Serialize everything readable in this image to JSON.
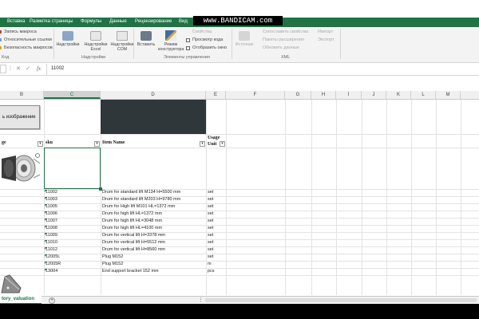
{
  "ribbon_tabs": [
    "Вставка",
    "Разметка страницы",
    "Формулы",
    "Данные",
    "Рецензирование",
    "Вид"
  ],
  "watermark": "www.BANDICAM.com",
  "ribbon": {
    "code_group": {
      "items": [
        "Запись макроса",
        "Относительные ссылки",
        "Безопасность макросов"
      ],
      "name": "Код"
    },
    "addins_group": {
      "buttons": [
        "Надстройки",
        "Надстройки Excel",
        "Надстройки COM"
      ],
      "name": "Надстройки"
    },
    "controls_group": {
      "insert_label": "Вставить",
      "design_mode_label": "Режим конструктора",
      "items": [
        "Свойства",
        "Просмотр кода",
        "Отобразить окно"
      ],
      "name": "Элементы управления"
    },
    "xml_group": {
      "source_label": "Источник",
      "items": [
        "Сопоставить свойства",
        "Пакеты расширения",
        "Обновить данные"
      ],
      "import_label": "Импорт",
      "export_label": "Экспорт",
      "name": "XML"
    }
  },
  "formula_bar": {
    "fx_label": "fx",
    "value": "11002"
  },
  "columns": [
    "B",
    "C",
    "D",
    "E",
    "F",
    "G",
    "H",
    "I",
    "J",
    "K",
    "L",
    "M"
  ],
  "sheet": {
    "button_text": "ь изображение",
    "header": {
      "image": "ge",
      "sku": "sku",
      "item_name": "Item Name",
      "usage_unit": "Usage Unit"
    },
    "rows": [
      {
        "sku": "11002",
        "name": "Drum for standard lift M134 H=5500 mm",
        "unit": "set"
      },
      {
        "sku": "11003",
        "name": "Drum for standard lift M203 H=9780 mm",
        "unit": "set"
      },
      {
        "sku": "11005",
        "name": "Drum for High lift M101 HL=1372 mm",
        "unit": "set"
      },
      {
        "sku": "11006",
        "name": "Drum for high lift HL=1372 mm",
        "unit": "set"
      },
      {
        "sku": "11007",
        "name": "Drum for high lift HL=3048 mm",
        "unit": "set"
      },
      {
        "sku": "11008",
        "name": "Drum for high lift HL=4100 mm",
        "unit": "set"
      },
      {
        "sku": "11009",
        "name": "Drum for vertical lift H=3378 mm",
        "unit": "set"
      },
      {
        "sku": "11010",
        "name": "Drum for vertical lift H=5512 mm",
        "unit": "set"
      },
      {
        "sku": "11012",
        "name": "Drum for vertical lift H=8560 mm",
        "unit": "set"
      },
      {
        "sku": "12005L",
        "name": "Plug M152",
        "unit": "set"
      },
      {
        "sku": "12005R",
        "name": "Plug M152",
        "unit": "m"
      },
      {
        "sku": "13004",
        "name": "End support bracket 152 mm",
        "unit": "pcs"
      }
    ]
  },
  "sheet_tab": "tory_valuation",
  "add_sheet": "+"
}
